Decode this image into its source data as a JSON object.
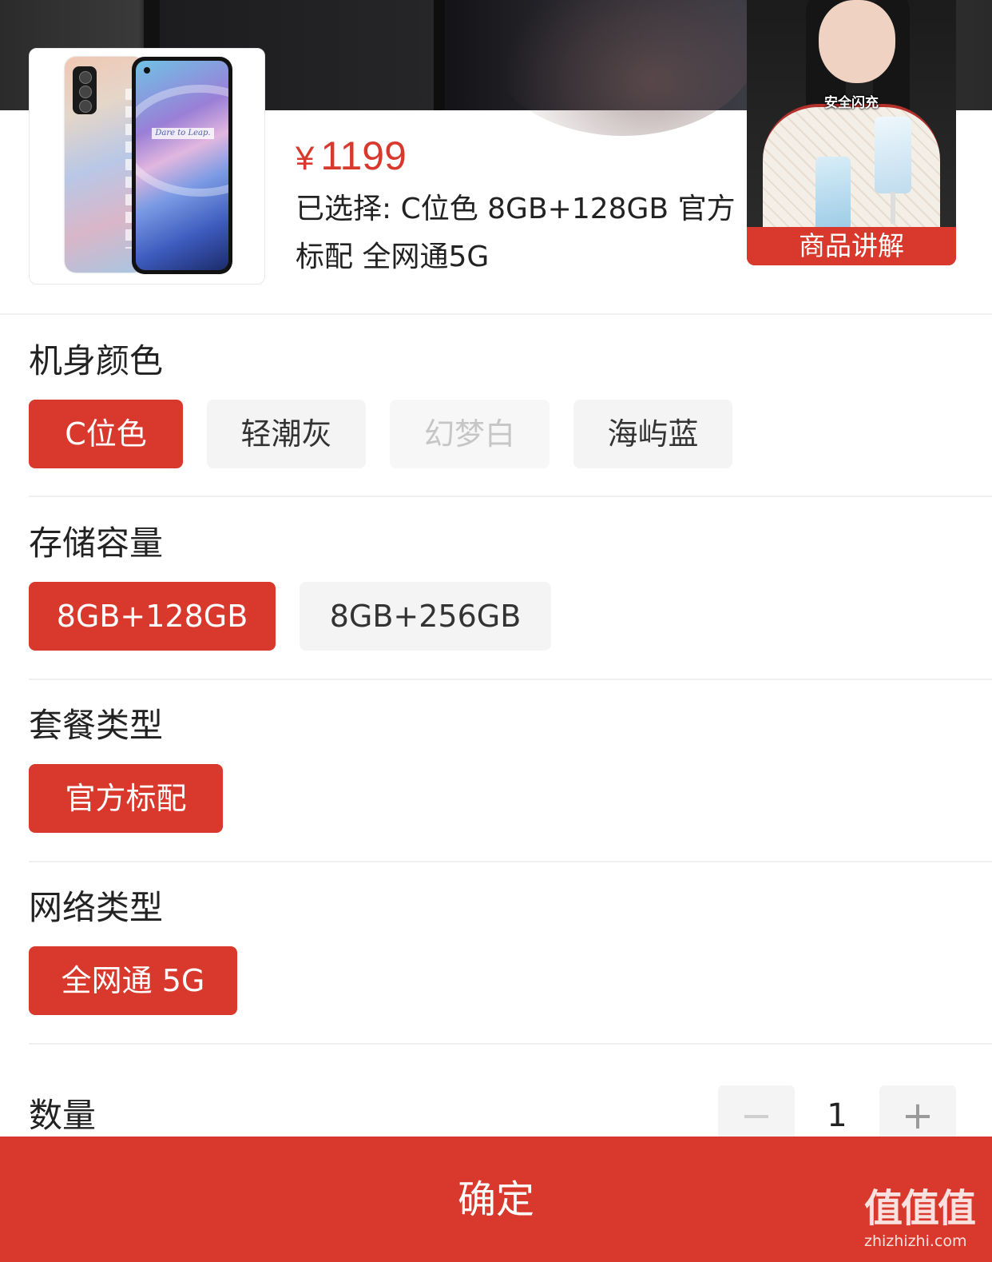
{
  "product": {
    "price": "1199",
    "currency_symbol": "¥",
    "selected_text": "已选择: C位色 8GB+128GB 官方标配 全网通5G"
  },
  "video_pip": {
    "caption": "安全闪充",
    "label": "商品讲解"
  },
  "sections": {
    "color": {
      "title": "机身颜色",
      "options": [
        "C位色",
        "轻潮灰",
        "幻梦白",
        "海屿蓝"
      ],
      "selected": "C位色",
      "disabled": [
        "幻梦白"
      ]
    },
    "storage": {
      "title": "存储容量",
      "options": [
        "8GB+128GB",
        "8GB+256GB"
      ],
      "selected": "8GB+128GB"
    },
    "package": {
      "title": "套餐类型",
      "options": [
        "官方标配"
      ],
      "selected": "官方标配"
    },
    "network": {
      "title": "网络类型",
      "options": [
        "全网通 5G"
      ],
      "selected": "全网通 5G"
    }
  },
  "quantity": {
    "label": "数量",
    "value": "1",
    "minus_symbol": "−",
    "plus_symbol": "+"
  },
  "footer": {
    "confirm_label": "确定"
  },
  "watermark": {
    "logo": "值值值",
    "domain": "zhizhizhi.com"
  },
  "colors": {
    "accent": "#d8392c",
    "chip_bg": "#f4f4f4",
    "disabled_text": "#c6c6c6"
  }
}
